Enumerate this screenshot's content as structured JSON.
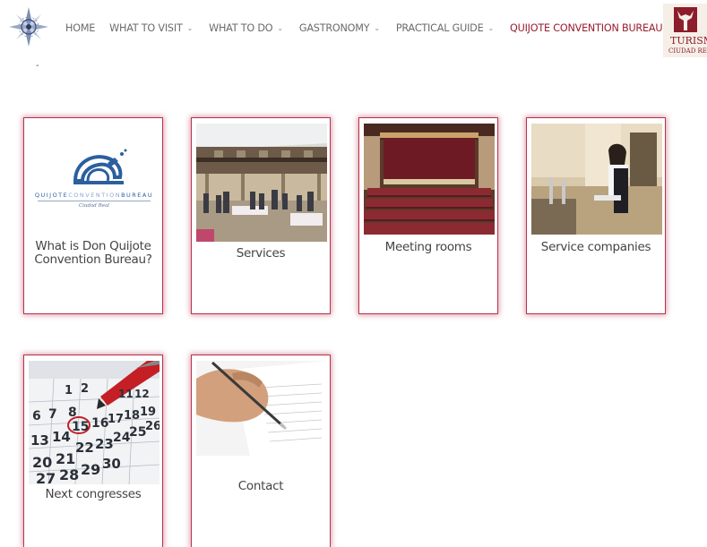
{
  "header": {
    "logo_icon": "compass-rose-icon",
    "logo_caption": "-",
    "nav": [
      {
        "label": "HOME",
        "has_dropdown": false,
        "active": false
      },
      {
        "label": "WHAT TO VISIT",
        "has_dropdown": true,
        "active": false
      },
      {
        "label": "WHAT TO DO",
        "has_dropdown": true,
        "active": false
      },
      {
        "label": "GASTRONOMY",
        "has_dropdown": true,
        "active": false
      },
      {
        "label": "PRACTICAL GUIDE",
        "has_dropdown": true,
        "active": false
      },
      {
        "label": "QUIJOTE CONVENTION BUREAU",
        "has_dropdown": true,
        "active": true
      }
    ],
    "chevron_glyph": "⌄",
    "brand_text": "TURISMO",
    "brand_sub": "CIUDAD REAL"
  },
  "colors": {
    "accent": "#9a1b2f",
    "card_border": "#b8324a",
    "nav_text": "#6b6b6b"
  },
  "logo_card": {
    "wordmark_left": "QUIJOTE",
    "wordmark_mid": "CONVENTION",
    "wordmark_right": "BUREAU",
    "tagline": "Ciudad Real"
  },
  "cards": [
    {
      "label": "What is Don Quijote Convention Bureau?",
      "image": "quijote-convention-bureau-logo"
    },
    {
      "label": "Services",
      "image": "courtyard-event-photo"
    },
    {
      "label": "Meeting rooms",
      "image": "auditorium-photo"
    },
    {
      "label": "Service companies",
      "image": "waitress-bar-photo"
    },
    {
      "label": "Next congresses",
      "image": "calendar-red-pen-photo"
    },
    {
      "label": "Contact",
      "image": "hand-signing-document-photo"
    }
  ],
  "calendar_numbers": [
    "1",
    "2",
    "11",
    "12",
    "6",
    "7",
    "8",
    "15",
    "16",
    "17",
    "18",
    "19",
    "13",
    "14",
    "22",
    "23",
    "24",
    "25",
    "26",
    "20",
    "21",
    "27",
    "28",
    "29",
    "30"
  ]
}
